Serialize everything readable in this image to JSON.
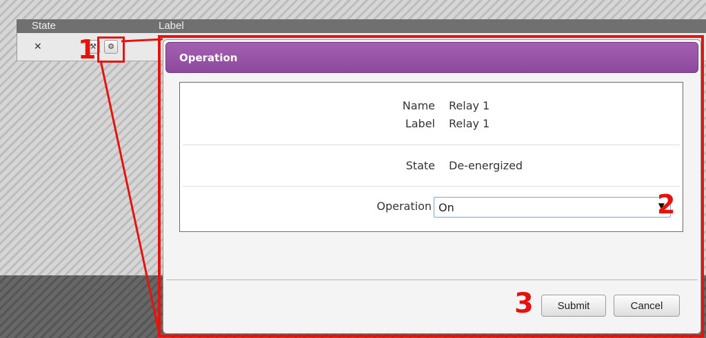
{
  "background_table": {
    "columns": [
      "State",
      "Label"
    ],
    "row": {
      "state_symbol": "✕",
      "edit_icon": "wrench-icon",
      "operate_icon": "gear-icon"
    }
  },
  "annotations": {
    "step1": "1",
    "step2": "2",
    "step3": "3",
    "color": "#e8120c"
  },
  "dialog": {
    "title": "Operation",
    "title_color": "#9a55a9",
    "fields": {
      "name_label": "Name",
      "name_value": "Relay 1",
      "label_label": "Label",
      "label_value": "Relay 1",
      "state_label": "State",
      "state_value": "De-energized",
      "operation_label": "Operation",
      "operation_value": "On"
    },
    "buttons": {
      "submit": "Submit",
      "cancel": "Cancel"
    }
  }
}
